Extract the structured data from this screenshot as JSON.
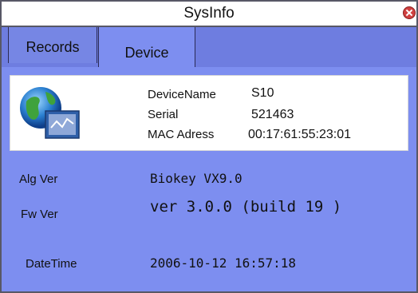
{
  "window": {
    "title": "SysInfo"
  },
  "tabs": [
    {
      "label": "Records",
      "active": false
    },
    {
      "label": "Device",
      "active": true
    }
  ],
  "device_info": {
    "icon": "globe-chart-icon",
    "rows": [
      {
        "label": "DeviceName",
        "value": "S10"
      },
      {
        "label": "Serial",
        "value": "521463"
      },
      {
        "label": "MAC Adress",
        "value": "00:17:61:55:23:01"
      }
    ]
  },
  "system_info": [
    {
      "label": "Alg Ver",
      "value": "Biokey VX9.0"
    },
    {
      "label": "Fw Ver",
      "value": "ver 3.0.0 (build 19 )"
    },
    {
      "label": "DateTime",
      "value": "2006-10-12 16:57:18"
    }
  ],
  "colors": {
    "panel_bg": "#7d8ef0",
    "border": "#585866",
    "close_button": "#d04040"
  }
}
